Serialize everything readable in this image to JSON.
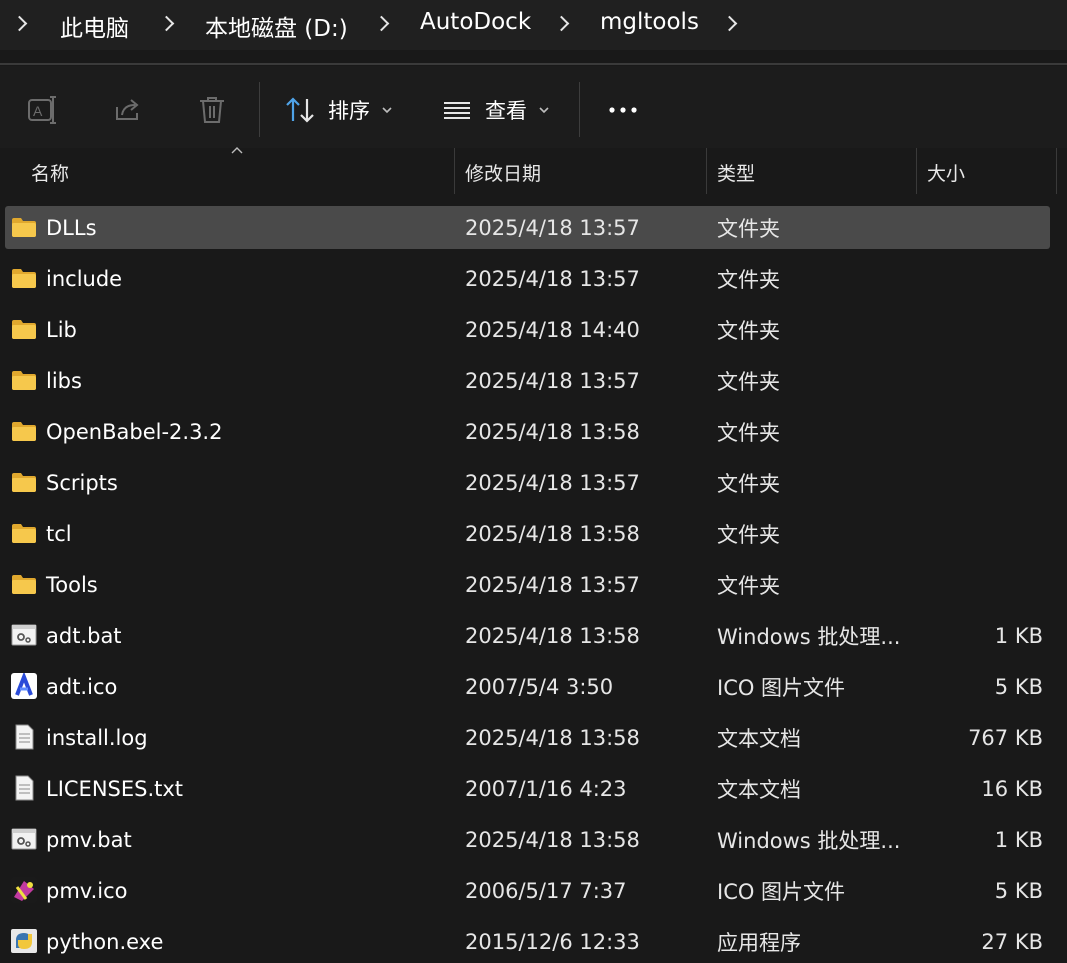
{
  "breadcrumb": {
    "items": [
      "此电脑",
      "本地磁盘 (D:)",
      "AutoDock",
      "mgltools"
    ]
  },
  "toolbar": {
    "sort_label": "排序",
    "view_label": "查看"
  },
  "columns": {
    "name": "名称",
    "date": "修改日期",
    "type": "类型",
    "size": "大小"
  },
  "files": [
    {
      "name": "DLLs",
      "date": "2025/4/18 13:57",
      "type": "文件夹",
      "size": "",
      "icon": "folder-icon",
      "selected": true
    },
    {
      "name": "include",
      "date": "2025/4/18 13:57",
      "type": "文件夹",
      "size": "",
      "icon": "folder-icon"
    },
    {
      "name": "Lib",
      "date": "2025/4/18 14:40",
      "type": "文件夹",
      "size": "",
      "icon": "folder-icon"
    },
    {
      "name": "libs",
      "date": "2025/4/18 13:57",
      "type": "文件夹",
      "size": "",
      "icon": "folder-icon"
    },
    {
      "name": "OpenBabel-2.3.2",
      "date": "2025/4/18 13:58",
      "type": "文件夹",
      "size": "",
      "icon": "folder-icon"
    },
    {
      "name": "Scripts",
      "date": "2025/4/18 13:57",
      "type": "文件夹",
      "size": "",
      "icon": "folder-icon"
    },
    {
      "name": "tcl",
      "date": "2025/4/18 13:58",
      "type": "文件夹",
      "size": "",
      "icon": "folder-icon"
    },
    {
      "name": "Tools",
      "date": "2025/4/18 13:57",
      "type": "文件夹",
      "size": "",
      "icon": "folder-icon"
    },
    {
      "name": "adt.bat",
      "date": "2025/4/18 13:58",
      "type": "Windows 批处理...",
      "size": "1 KB",
      "icon": "batch-file-icon"
    },
    {
      "name": "adt.ico",
      "date": "2007/5/4 3:50",
      "type": "ICO 图片文件",
      "size": "5 KB",
      "icon": "adt-ico-icon"
    },
    {
      "name": "install.log",
      "date": "2025/4/18 13:58",
      "type": "文本文档",
      "size": "767 KB",
      "icon": "text-file-icon"
    },
    {
      "name": "LICENSES.txt",
      "date": "2007/1/16 4:23",
      "type": "文本文档",
      "size": "16 KB",
      "icon": "text-file-icon"
    },
    {
      "name": "pmv.bat",
      "date": "2025/4/18 13:58",
      "type": "Windows 批处理...",
      "size": "1 KB",
      "icon": "batch-file-icon"
    },
    {
      "name": "pmv.ico",
      "date": "2006/5/17 7:37",
      "type": "ICO 图片文件",
      "size": "5 KB",
      "icon": "pmv-ico-icon"
    },
    {
      "name": "python.exe",
      "date": "2015/12/6 12:33",
      "type": "应用程序",
      "size": "27 KB",
      "icon": "python-exe-icon"
    }
  ],
  "colors": {
    "background": "#191919",
    "selected_row": "#4a4a4a",
    "folder": "#f6c84c"
  }
}
